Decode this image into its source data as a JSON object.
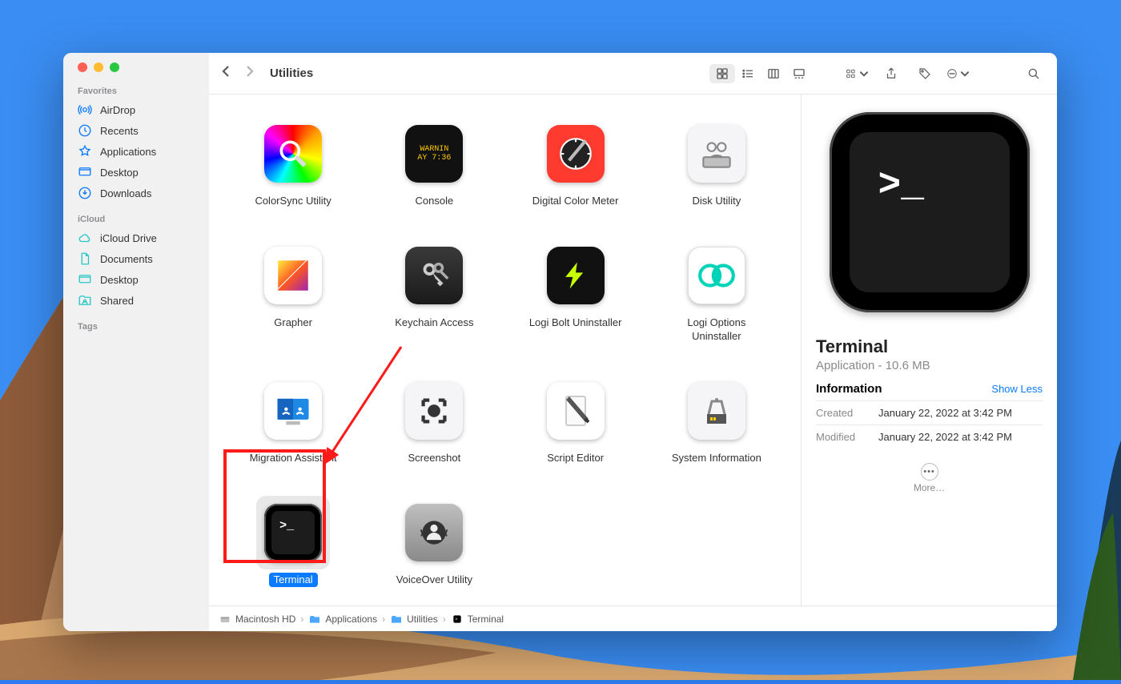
{
  "sidebar": {
    "sections": [
      {
        "heading": "Favorites",
        "items": [
          {
            "icon": "airdrop",
            "label": "AirDrop"
          },
          {
            "icon": "recents",
            "label": "Recents"
          },
          {
            "icon": "applications",
            "label": "Applications"
          },
          {
            "icon": "desktop",
            "label": "Desktop"
          },
          {
            "icon": "downloads",
            "label": "Downloads"
          }
        ]
      },
      {
        "heading": "iCloud",
        "items": [
          {
            "icon": "icloud",
            "label": "iCloud Drive"
          },
          {
            "icon": "documents",
            "label": "Documents"
          },
          {
            "icon": "desktop",
            "label": "Desktop"
          },
          {
            "icon": "shared",
            "label": "Shared"
          }
        ]
      },
      {
        "heading": "Tags",
        "items": []
      }
    ]
  },
  "toolbar": {
    "title": "Utilities"
  },
  "apps": [
    {
      "name": "ColorSync Utility",
      "icon": "colorsync"
    },
    {
      "name": "Console",
      "icon": "console"
    },
    {
      "name": "Digital Color Meter",
      "icon": "digitalcolor"
    },
    {
      "name": "Disk Utility",
      "icon": "diskutility"
    },
    {
      "name": "Grapher",
      "icon": "grapher"
    },
    {
      "name": "Keychain Access",
      "icon": "keychain"
    },
    {
      "name": "Logi Bolt Uninstaller",
      "icon": "logibolt"
    },
    {
      "name": "Logi Options Uninstaller",
      "icon": "logioptions"
    },
    {
      "name": "Migration Assistant",
      "icon": "migration"
    },
    {
      "name": "Screenshot",
      "icon": "screenshot"
    },
    {
      "name": "Script Editor",
      "icon": "scripteditor"
    },
    {
      "name": "System Information",
      "icon": "sysinfo"
    },
    {
      "name": "Terminal",
      "icon": "terminal",
      "selected": true
    },
    {
      "name": "VoiceOver Utility",
      "icon": "voiceover"
    }
  ],
  "preview": {
    "title": "Terminal",
    "subtitle": "Application - 10.6 MB",
    "info_heading": "Information",
    "show_less": "Show Less",
    "rows": [
      {
        "k": "Created",
        "v": "January 22, 2022 at 3:42 PM"
      },
      {
        "k": "Modified",
        "v": "January 22, 2022 at 3:42 PM"
      }
    ],
    "more": "More…"
  },
  "pathbar": [
    "Macintosh HD",
    "Applications",
    "Utilities",
    "Terminal"
  ]
}
